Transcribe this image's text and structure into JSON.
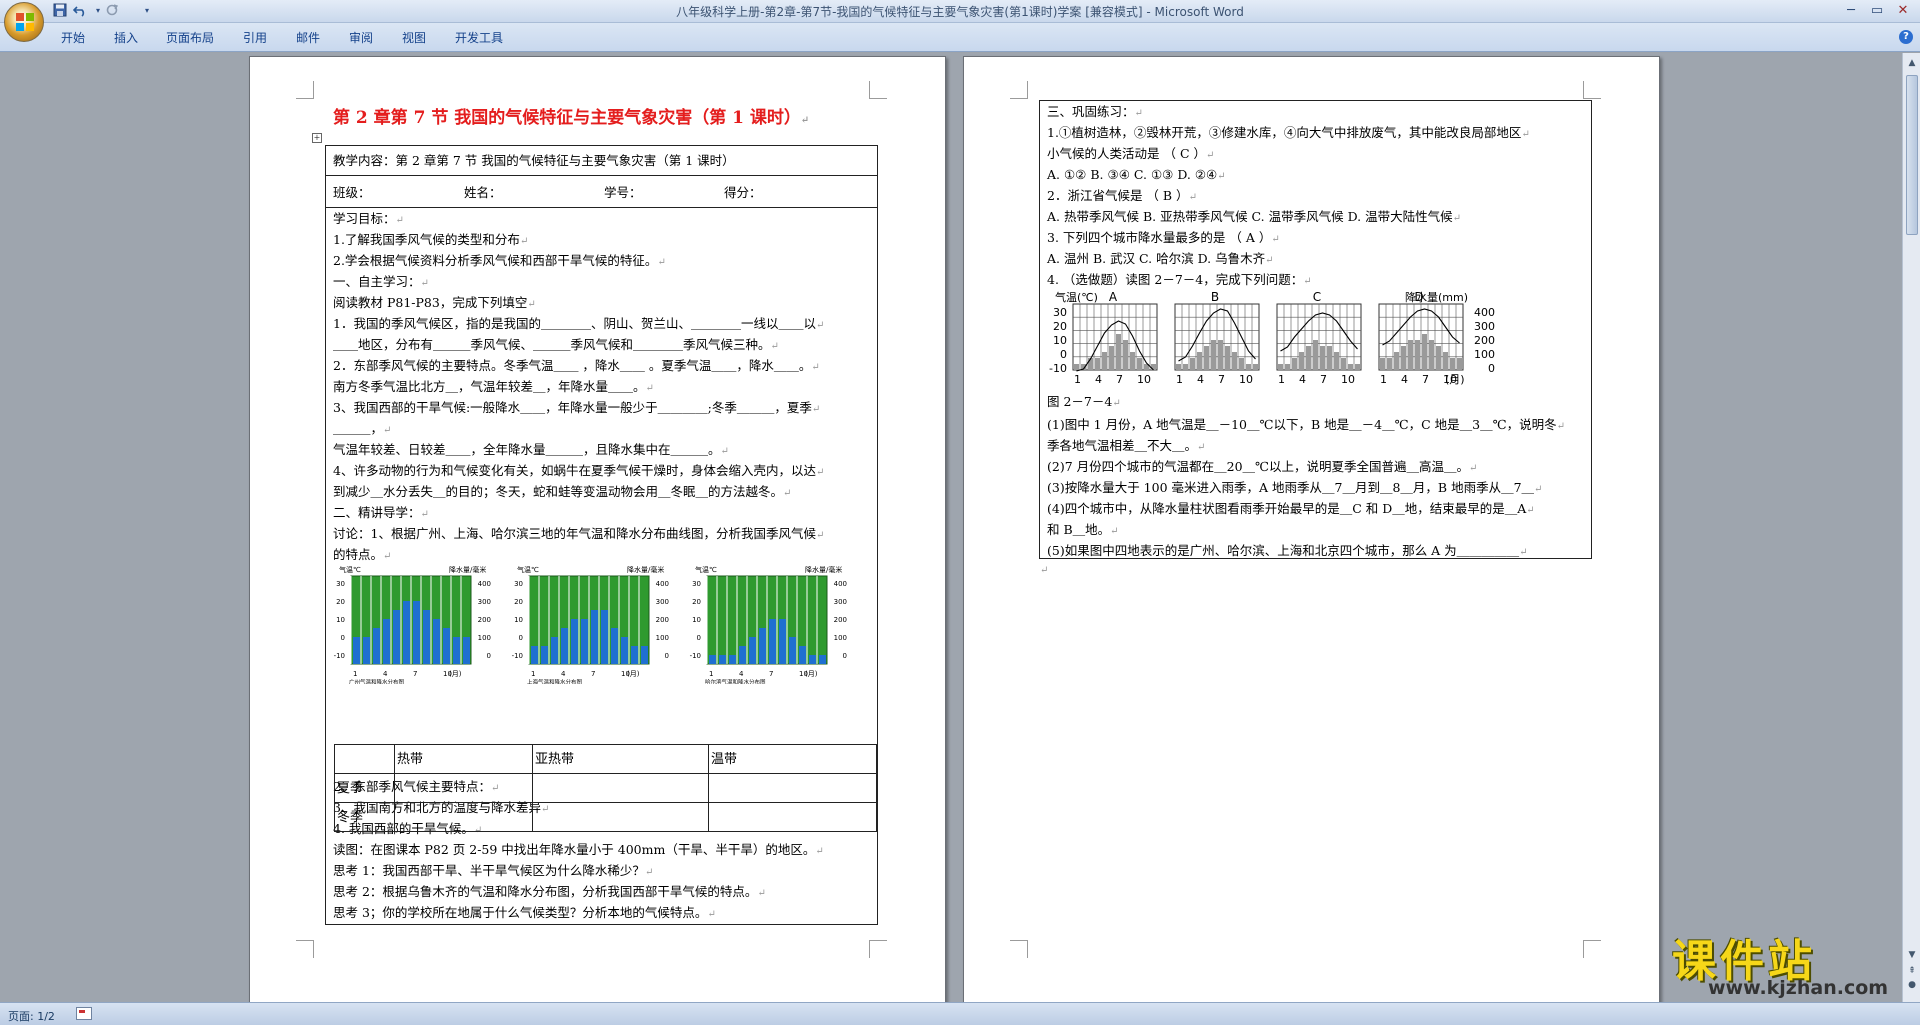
{
  "window": {
    "title": "八年级科学上册-第2章-第7节-我国的气候特征与主要气象灾害(第1课时)学案 [兼容模式] - Microsoft Word"
  },
  "ribbon": {
    "tabs": [
      "开始",
      "插入",
      "页面布局",
      "引用",
      "邮件",
      "审阅",
      "视图",
      "开发工具"
    ]
  },
  "status": {
    "page": "页面: 1/2"
  },
  "watermark": {
    "text": "课件站",
    "url": "www.kjzhan.com"
  },
  "page1": {
    "title": "第 2 章第 7 节  我国的气候特征与主要气象灾害（第 1 课时）",
    "content_line": "教学内容：第 2 章第 7 节 我国的气候特征与主要气象灾害（第 1 课时）",
    "info": {
      "class": "班级：",
      "name": "姓名：",
      "number": "学号：",
      "score": "得分："
    },
    "lines": [
      "学习目标：",
      "1.了解我国季风气候的类型和分布",
      "2.学会根据气候资料分析季风气候和西部干旱气候的特征。",
      "一、自主学习：",
      "阅读教材 P81-P83，完成下列填空",
      "1．我国的季风气候区，指的是我国的＿＿＿＿、阴山、贺兰山、＿＿＿＿一线以＿＿以",
      "＿＿地区，分布有＿＿＿季风气候、＿＿＿季风气候和＿＿＿＿季风气候三种。",
      "2．东部季风气候的主要特点。冬季气温＿＿ ，降水＿＿ 。夏季气温＿＿，降水＿＿。",
      "南方冬季气温比北方＿，气温年较差＿，年降水量＿＿。",
      "3、我国西部的干旱气候:一般降水＿＿，年降水量一般少于＿＿＿＿;冬季＿＿＿，夏季",
      "＿＿＿，",
      "气温年较差、日较差＿＿，全年降水量＿＿＿，且降水集中在＿＿＿。",
      "4、许多动物的行为和气候变化有关，如蜗牛在夏季气候干燥时，身体会缩入壳内，以达",
      "到减少＿水分丢失＿的目的；冬天，蛇和蛙等变温动物会用＿冬眠＿的方法越冬。",
      "二、精讲导学：",
      "讨论：1、根据广州、上海、哈尔滨三地的年气温和降水分布曲线图，分析我国季风气候",
      "的特点。"
    ],
    "climate_charts": {
      "left_axis": "气温℃",
      "right_axis": "降水量/毫米",
      "x_unit": "(月)",
      "temp_ticks": [
        "30",
        "20",
        "10",
        "0",
        "-10"
      ],
      "rain_ticks": [
        "400",
        "300",
        "200",
        "100",
        "0"
      ],
      "month_ticks": [
        "1",
        "4",
        "7",
        "10"
      ],
      "captions": [
        "广州气温和降水分布图",
        "上海气温和降水分布图",
        "哈尔滨气温和降水分布图"
      ]
    },
    "table": {
      "headers": [
        "",
        "热带",
        "亚热带",
        "温带"
      ],
      "rows": [
        [
          "夏季",
          "",
          "",
          ""
        ],
        [
          "冬季",
          "",
          "",
          ""
        ]
      ]
    },
    "after_lines": [
      "2、东部季风气候主要特点：",
      "3、我国南方和北方的温度与降水差异",
      "4. 我国西部的干旱气候。",
      "读图：在图课本 P82 页 2-59 中找出年降水量小于 400mm（干旱、半干旱）的地区。",
      "思考 1：我国西部干旱、半干旱气候区为什么降水稀少？",
      "思考 2：根据乌鲁木齐的气温和降水分布图，分析我国西部干旱气候的特点。",
      "思考 3；你的学校所在地属于什么气候类型？分析本地的气候特点。"
    ]
  },
  "page2": {
    "lines": [
      "三、巩固练习：",
      "1.①植树造林，②毁林开荒，③修建水库，④向大气中排放废气，其中能改良局部地区",
      "小气候的人类活动是                                    （  C  ）",
      "A. ①②       B. ③④         C. ①③           D. ②④",
      "2．浙江省气候是                                       （ B ）",
      "A. 热带季风气候 B. 亚热带季风气候 C. 温带季风气候  D. 温带大陆性气候",
      "3. 下列四个城市降水量最多的是                             （ A ）",
      "A. 温州            B. 武汉       C. 哈尔滨            D. 乌鲁木齐",
      "4. （选做题）读图 2－7－4，完成下列问题："
    ],
    "figure": {
      "left_label": "气温(℃)",
      "right_label": "降水量(mm)",
      "stations": [
        "A",
        "B",
        "C",
        "D"
      ],
      "temp_ticks": [
        "30",
        "20",
        "10",
        "0",
        "-10"
      ],
      "rain_ticks": [
        "400",
        "300",
        "200",
        "100",
        "0"
      ],
      "month_ticks": [
        "1",
        "4",
        "7",
        "10"
      ],
      "month_unit": "(月)",
      "caption": "图 2－7－4"
    },
    "answers": [
      "(1)图中 1 月份，A 地气温是＿－10＿℃以下，B 地是＿－4＿℃，C 地是＿3＿℃，说明冬",
      "季各地气温相差＿不大＿。",
      "(2)7 月份四个城市的气温都在＿20＿℃以上，说明夏季全国普遍＿高温＿。",
      "(3)按降水量大于 100 毫米进入雨季，A 地雨季从＿7＿月到＿8＿月，B 地雨季从＿7＿",
      "(4)四个城市中，从降水量柱状图看雨季开始最早的是＿C 和 D＿地，结束最早的是＿A",
      "和 B＿地。",
      "(5)如果图中四地表示的是广州、哈尔滨、上海和北京四个城市，那么 A 为＿＿＿＿＿"
    ]
  },
  "colors": {
    "title_red": "#e41d1d",
    "bar_green": "#2f9a2f",
    "bar_blue": "#1f6fd1",
    "page_bg": "#ffffff",
    "workspace": "#9ea5ae"
  },
  "icons": [
    "office-button",
    "save-icon",
    "undo-icon",
    "redo-icon",
    "minimize-icon",
    "maximize-icon",
    "close-icon",
    "help-icon",
    "table-anchor-icon"
  ]
}
